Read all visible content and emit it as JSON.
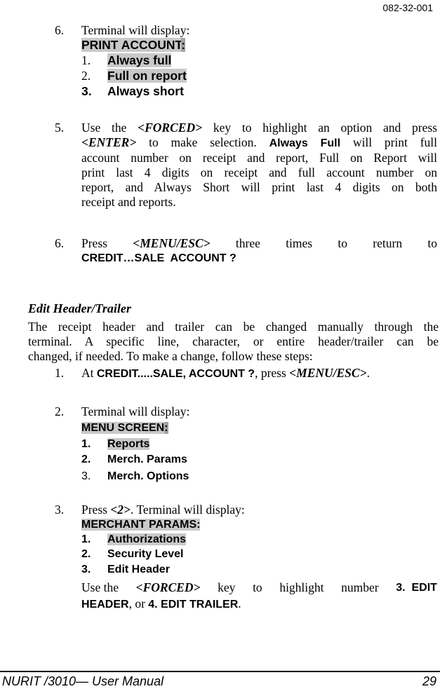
{
  "header": {
    "doc_number": "082-32-001"
  },
  "step6a": {
    "number": "6.",
    "text": "Terminal will display:",
    "screen_title": "PRINT ACCOUNT",
    "screen_colon": ":",
    "options": [
      {
        "num": "1.",
        "label": "Always full"
      },
      {
        "num": "2.",
        "label": "Full on report"
      },
      {
        "num": "3.",
        "label": "Always short"
      }
    ]
  },
  "step5": {
    "number": "5.",
    "line1_a": "Use the ",
    "line1_key": "<FORCED>",
    "line1_b": " key to highlight an option and press",
    "line2_key": "<ENTER>",
    "line2_a": " to make selection.  ",
    "line2_bold": "Always Full",
    "line2_b": " will print full",
    "line3": "account number on receipt and report, Full on Report will",
    "line4": "print last 4 digits on receipt and full account number on",
    "line5": "report, and Always Short will print last 4 digits on both",
    "line6": "receipt and reports."
  },
  "step6b": {
    "number": "6.",
    "line1_a": "Press",
    "line1_key": "<MENU/ESC>",
    "line1_words": [
      "three",
      "times",
      "to",
      "return",
      "to"
    ],
    "line2": "CREDIT…SALE  ACCOUNT ?"
  },
  "section": {
    "heading": "Edit Header/Trailer",
    "para_line1": "The receipt header and trailer can be changed manually through the",
    "para_line2": "terminal.  A specific line, character, or entire header/trailer can be",
    "para_line3": "changed, if needed.  To make a change, follow these steps:",
    "steps": [
      {
        "number": "1.",
        "a": "At ",
        "bold": "CREDIT.....SALE, ACCOUNT ?",
        "b": ", press ",
        "key": "<MENU/ESC>",
        "c": "."
      },
      {
        "number": "2.",
        "text": "Terminal will display:",
        "screen_title": "MENU SCREEN",
        "screen_colon": ":",
        "options": [
          {
            "num": "1.",
            "label": "Reports"
          },
          {
            "num": "2.",
            "label": "Merch. Params"
          },
          {
            "num": "3.",
            "label": "Merch. Options"
          }
        ]
      },
      {
        "number": "3.",
        "a": "Press ",
        "key": "<2>",
        "b": ". Terminal will display:",
        "screen_title": "MERCHANT PARAMS:",
        "options": [
          {
            "num": "1.",
            "label": "Authorizations"
          },
          {
            "num": "2.",
            "label": "Security Level"
          },
          {
            "num": "3.",
            "label": "Edit Header"
          }
        ],
        "after_line1_a": "Use the",
        "after_line1_key": "<FORCED>",
        "after_line1_words": [
          "key",
          "to",
          "highlight",
          "number"
        ],
        "after_line1_bold": "3.  EDIT",
        "after_line2_bold_a": "HEADER",
        "after_line2_a": ", or ",
        "after_line2_bold_b": "4. EDIT TRAILER",
        "after_line2_b": "."
      }
    ]
  },
  "footer": {
    "title": "NURIT /3010— User Manual",
    "page": "29"
  }
}
